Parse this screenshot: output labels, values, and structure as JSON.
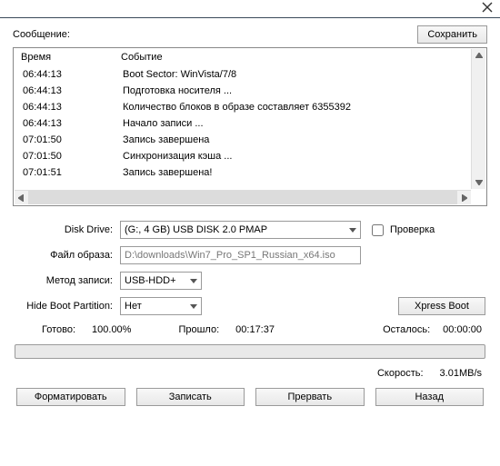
{
  "header": {
    "message_label": "Сообщение:",
    "save_button": "Сохранить"
  },
  "log": {
    "col_time": "Время",
    "col_event": "Событие",
    "rows": [
      {
        "time": "06:44:13",
        "event": "Boot Sector: WinVista/7/8"
      },
      {
        "time": "06:44:13",
        "event": "Подготовка носителя ..."
      },
      {
        "time": "06:44:13",
        "event": "Количество блоков в образе составляет 6355392"
      },
      {
        "time": "06:44:13",
        "event": "Начало записи ..."
      },
      {
        "time": "07:01:50",
        "event": "Запись завершена"
      },
      {
        "time": "07:01:50",
        "event": "Синхронизация кэша ..."
      },
      {
        "time": "07:01:51",
        "event": "Запись завершена!"
      }
    ]
  },
  "form": {
    "drive_label": "Disk Drive:",
    "drive_value": "(G:, 4 GB)     USB DISK 2.0   PMAP",
    "verify_label": "Проверка",
    "image_label": "Файл образа:",
    "image_value": "D:\\downloads\\Win7_Pro_SP1_Russian_x64.iso",
    "method_label": "Метод записи:",
    "method_value": "USB-HDD+",
    "hbp_label": "Hide Boot Partition:",
    "hbp_value": "Нет",
    "xpress_button": "Xpress Boot"
  },
  "status": {
    "ready_label": "Готово:",
    "ready_value": "100.00%",
    "elapsed_label": "Прошло:",
    "elapsed_value": "00:17:37",
    "remaining_label": "Осталось:",
    "remaining_value": "00:00:00"
  },
  "speed": {
    "label": "Скорость:",
    "value": "3.01MB/s"
  },
  "buttons": {
    "format": "Форматировать",
    "write": "Записать",
    "abort": "Прервать",
    "back": "Назад"
  }
}
